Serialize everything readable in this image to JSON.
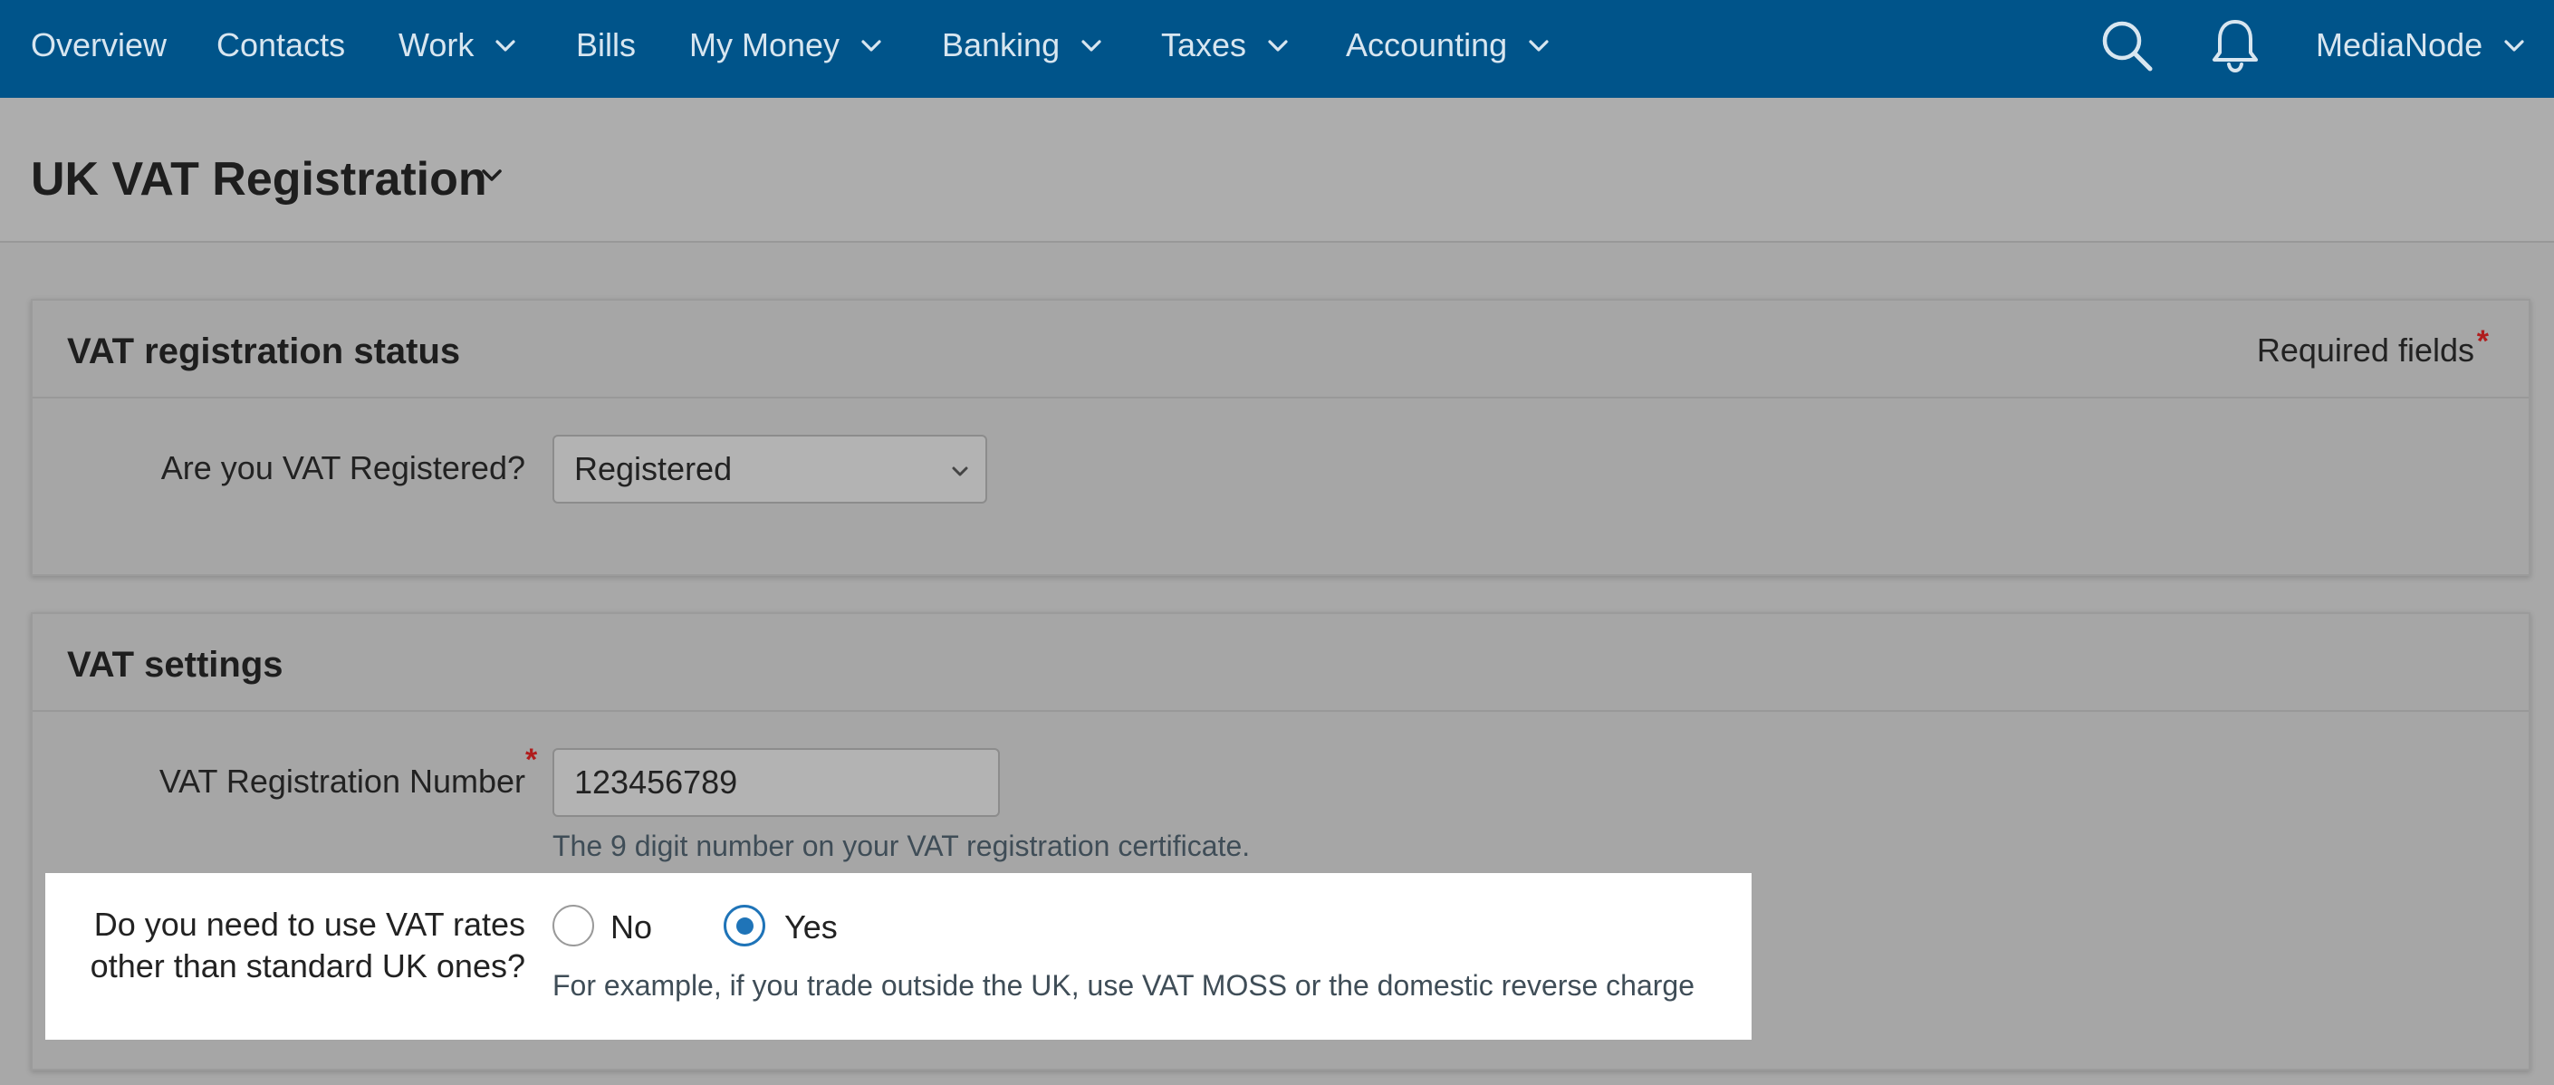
{
  "nav": {
    "items": [
      {
        "label": "Overview",
        "has_menu": false
      },
      {
        "label": "Contacts",
        "has_menu": false
      },
      {
        "label": "Work",
        "has_menu": true
      },
      {
        "label": "Bills",
        "has_menu": false
      },
      {
        "label": "My Money",
        "has_menu": true
      },
      {
        "label": "Banking",
        "has_menu": true
      },
      {
        "label": "Taxes",
        "has_menu": true
      },
      {
        "label": "Accounting",
        "has_menu": true
      }
    ],
    "search_icon": "search-icon",
    "notifications_icon": "bell-icon",
    "account_label": "MediaNode"
  },
  "colors": {
    "nav_bg": "#00548a",
    "accent": "#1f74b8",
    "required_star": "#b01d1d"
  },
  "page": {
    "title": "UK VAT Registration"
  },
  "status_panel": {
    "title": "VAT registration status",
    "required_note": "Required fields",
    "required_star": "*",
    "registered_question": "Are you VAT Registered?",
    "registered_value": "Registered"
  },
  "settings_panel": {
    "title": "VAT settings",
    "vat_number_label": "VAT Registration Number",
    "vat_number_star": "*",
    "vat_number_value": "123456789",
    "vat_number_hint": "The 9 digit number on your VAT registration certificate.",
    "rates_question_line1": "Do you need to use VAT rates",
    "rates_question_line2": "other than standard UK ones?",
    "option_no": "No",
    "option_yes": "Yes",
    "selected_option": "Yes",
    "rates_hint": "For example, if you trade outside the UK, use VAT MOSS or the domestic reverse charge"
  }
}
